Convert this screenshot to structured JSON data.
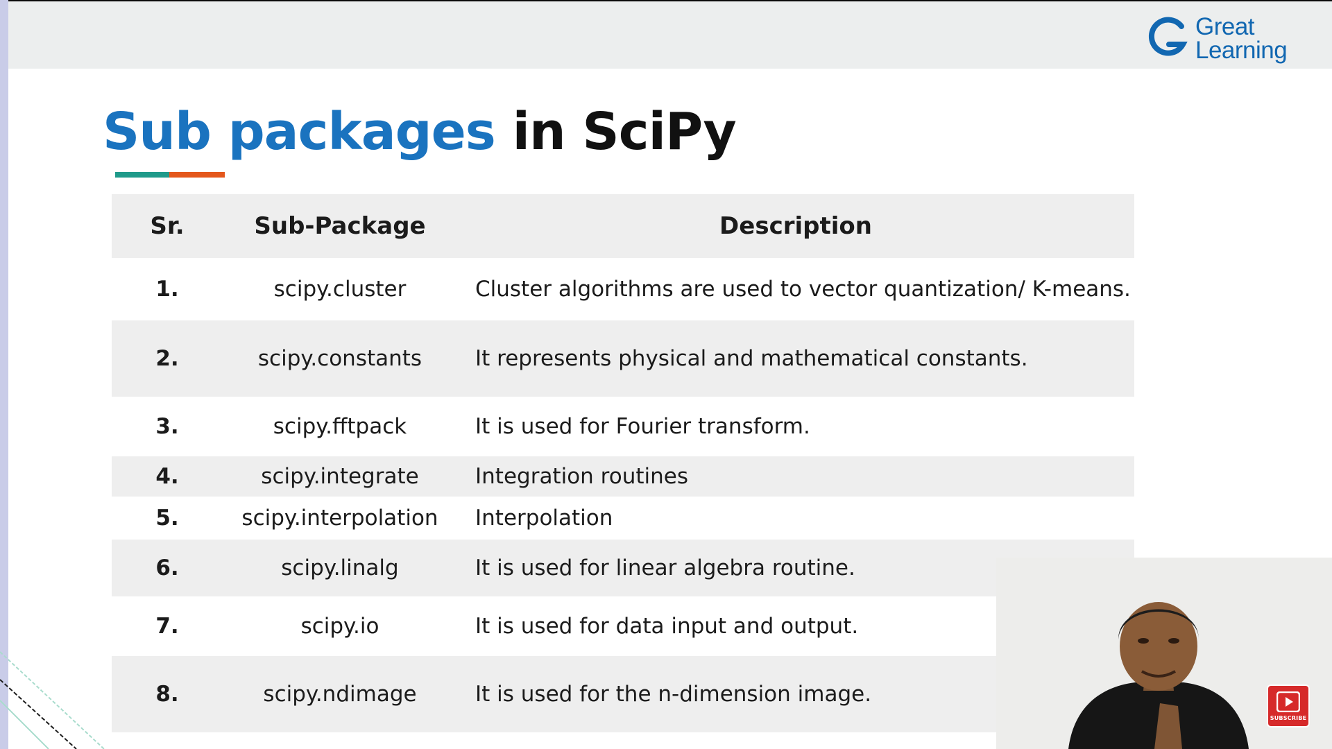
{
  "logo": {
    "line1": "Great",
    "line2": "Learning"
  },
  "slide": {
    "title_accent": "Sub packages",
    "title_rest": "in SciPy"
  },
  "table": {
    "headers": [
      "Sr.",
      "Sub-Package",
      "Description"
    ],
    "rows": [
      {
        "sr": "1.",
        "package": "scipy.cluster",
        "description": "Cluster algorithms are used to vector quantization/ K-means."
      },
      {
        "sr": "2.",
        "package": "scipy.constants",
        "description": "It represents physical and mathematical constants."
      },
      {
        "sr": "3.",
        "package": "scipy.fftpack",
        "description": "It is used for Fourier transform."
      },
      {
        "sr": "4.",
        "package": "scipy.integrate",
        "description": "Integration routines"
      },
      {
        "sr": "5.",
        "package": "scipy.interpolation",
        "description": "Interpolation"
      },
      {
        "sr": "6.",
        "package": "scipy.linalg",
        "description": "It is used for linear algebra routine."
      },
      {
        "sr": "7.",
        "package": "scipy.io",
        "description": "It is used for data input and output."
      },
      {
        "sr": "8.",
        "package": "scipy.ndimage",
        "description": "It is used for the n-dimension image."
      }
    ]
  },
  "subscribe": {
    "label": "SUBSCRIBE",
    "icon": "play-icon"
  },
  "colors": {
    "brand_blue": "#1a73bf",
    "teal": "#1f9a8a",
    "orange": "#e4571c",
    "subscribe_red": "#d62a2a",
    "row_shade": "#eeeeee"
  }
}
